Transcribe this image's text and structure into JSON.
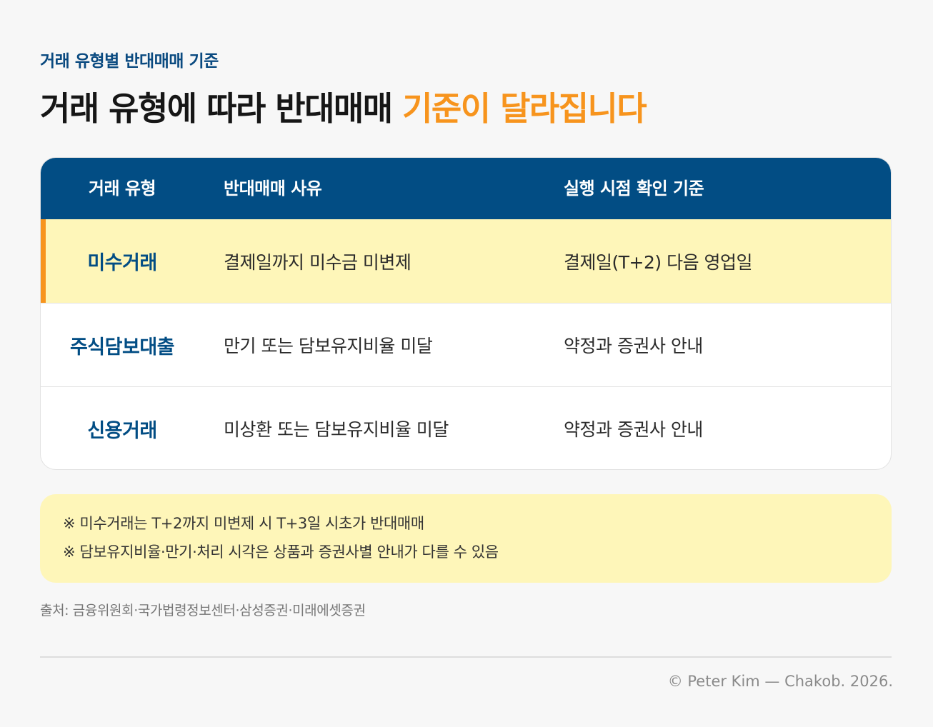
{
  "header": {
    "eyebrow": "거래 유형별 반대매매 기준",
    "headline_main": "거래 유형에 따라 반대매매 ",
    "headline_accent": "기준이 달라집니다",
    "accent_color": "#f7941d",
    "brand_color": "#024d84"
  },
  "table": {
    "columns": [
      "거래 유형",
      "반대매매 사유",
      "실행 시점 확인 기준"
    ],
    "rows": [
      {
        "type": "미수거래",
        "reason": "결제일까지 미수금 미변제",
        "timing": "결제일(T+2) 다음 영업일",
        "highlighted": true
      },
      {
        "type": "주식담보대출",
        "reason": "만기 또는 담보유지비율 미달",
        "timing": "약정과 증권사 안내",
        "highlighted": false
      },
      {
        "type": "신용거래",
        "reason": "미상환 또는 담보유지비율 미달",
        "timing": "약정과 증권사 안내",
        "highlighted": false
      }
    ]
  },
  "notes": [
    "※ 미수거래는 T+2까지 미변제 시 T+3일 시초가 반대매매",
    "※ 담보유지비율·만기·처리 시각은 상품과 증권사별 안내가 다를 수 있음"
  ],
  "source": "출처: 금융위원회·국가법령정보센터·삼성증권·미래에셋증권",
  "copyright": "© Peter Kim — Chakob. 2026."
}
